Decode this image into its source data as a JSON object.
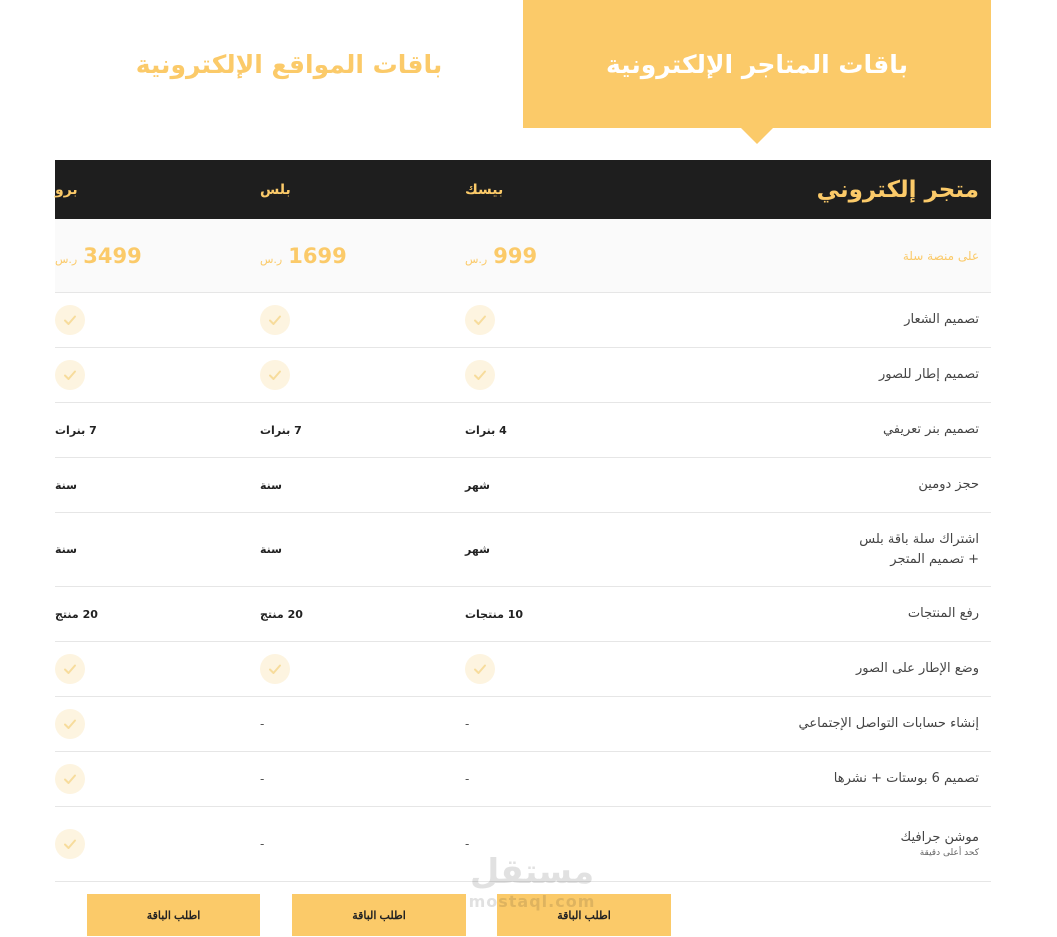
{
  "tabs": {
    "active": "باقات المتاجر الإلكترونية",
    "inactive": "باقات المواقع الإلكترونية"
  },
  "table": {
    "title": "متجر إلكتروني",
    "columns": [
      "بيسك",
      "بلس",
      "برو"
    ],
    "platform_label": "على منصة سلة",
    "prices": [
      {
        "amount": "999",
        "currency": "ر.س"
      },
      {
        "amount": "1699",
        "currency": "ر.س"
      },
      {
        "amount": "3499",
        "currency": "ر.س"
      }
    ],
    "features": [
      {
        "label": "تصميم الشعار",
        "values": [
          "check",
          "check",
          "check"
        ]
      },
      {
        "label": "تصميم إطار للصور",
        "values": [
          "check",
          "check",
          "check"
        ]
      },
      {
        "label": "تصميم بنر تعريفي",
        "values": [
          "4 بنرات",
          "7 بنرات",
          "7 بنرات"
        ]
      },
      {
        "label": "حجز دومين",
        "values": [
          "شهر",
          "سنة",
          "سنة"
        ]
      },
      {
        "label": "اشتراك سلة باقة بلس",
        "label2": "+ تصميم المتجر",
        "values": [
          "شهر",
          "سنة",
          "سنة"
        ]
      },
      {
        "label": "رفع المنتجات",
        "values": [
          "10 منتجات",
          "20 منتج",
          "20 منتج"
        ]
      },
      {
        "label": "وضع الإطار على الصور",
        "values": [
          "check",
          "check",
          "check"
        ]
      },
      {
        "label": "إنشاء حسابات التواصل الإجتماعي",
        "values": [
          "-",
          "-",
          "check"
        ]
      },
      {
        "label": "تصميم 6 بوستات + نشرها",
        "values": [
          "-",
          "-",
          "check"
        ]
      },
      {
        "label": "موشن جرافيك",
        "sub": "كحد أعلى دقيقة",
        "values": [
          "-",
          "-",
          "check"
        ]
      }
    ]
  },
  "buttons": [
    "اطلب الباقة",
    "اطلب الباقة",
    "اطلب الباقة"
  ],
  "watermark": {
    "main": "مستقل",
    "sub": "mostaql.com"
  },
  "colors": {
    "accent": "#fbca69",
    "header_bg": "#1e1e1e"
  }
}
